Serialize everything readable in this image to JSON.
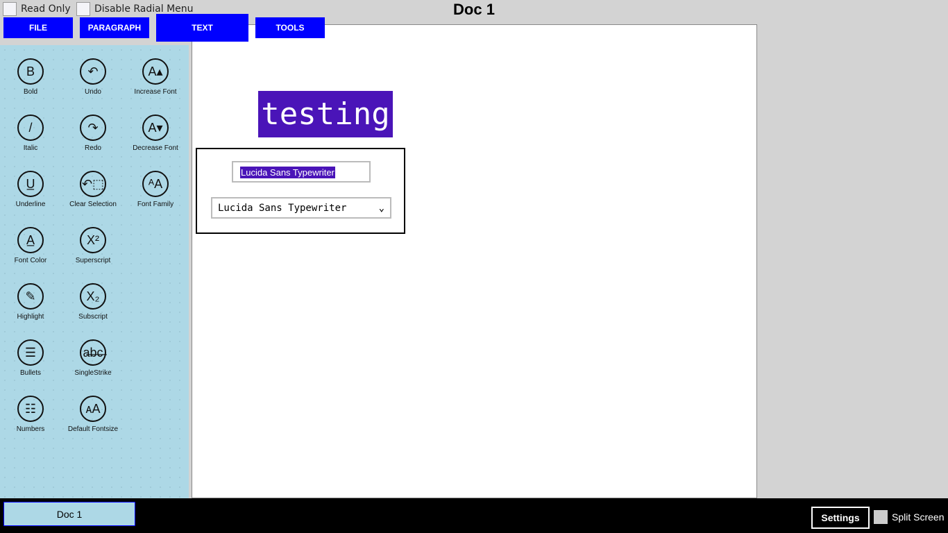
{
  "header": {
    "title": "Doc 1",
    "read_only": "Read Only",
    "disable_radial": "Disable Radial Menu"
  },
  "tabs": [
    {
      "label": "FILE"
    },
    {
      "label": "PARAGRAPH"
    },
    {
      "label": "TEXT",
      "active": true
    },
    {
      "label": "TOOLS"
    }
  ],
  "tools": [
    {
      "label": "Bold",
      "glyph": "B",
      "icon": "bold-icon"
    },
    {
      "label": "Undo",
      "glyph": "↶",
      "icon": "undo-icon"
    },
    {
      "label": "Increase Font",
      "glyph": "A▴",
      "icon": "increase-font-icon"
    },
    {
      "label": "Italic",
      "glyph": "/",
      "icon": "italic-icon"
    },
    {
      "label": "Redo",
      "glyph": "↷",
      "icon": "redo-icon"
    },
    {
      "label": "Decrease Font",
      "glyph": "A▾",
      "icon": "decrease-font-icon"
    },
    {
      "label": "Underline",
      "glyph": "U̲",
      "icon": "underline-icon"
    },
    {
      "label": "Clear Selection",
      "glyph": "↶⬚",
      "icon": "clear-selection-icon"
    },
    {
      "label": "Font Family",
      "glyph": "ᴬA",
      "icon": "font-family-icon"
    },
    {
      "label": "Font Color",
      "glyph": "A̲",
      "icon": "font-color-icon"
    },
    {
      "label": "Superscript",
      "glyph": "X²",
      "icon": "superscript-icon"
    },
    {
      "label": "Highlight",
      "glyph": "✎",
      "icon": "highlight-icon"
    },
    {
      "label": "Subscript",
      "glyph": "X₂",
      "icon": "subscript-icon"
    },
    {
      "label": "Bullets",
      "glyph": "☰",
      "icon": "bullets-icon"
    },
    {
      "label": "SingleStrike",
      "glyph": "a̶b̶c̶",
      "icon": "strikethrough-icon"
    },
    {
      "label": "Numbers",
      "glyph": "☷",
      "icon": "numbers-icon"
    },
    {
      "label": "Default Fontsize",
      "glyph": "ᴀA",
      "icon": "default-fontsize-icon"
    }
  ],
  "document": {
    "text": "testing",
    "font_input": "Lucida Sans Typewriter",
    "font_select": "Lucida Sans Typewriter",
    "highlight_color": "#4a14b8"
  },
  "footer": {
    "doc_tab": "Doc 1",
    "settings": "Settings",
    "split_screen": "Split Screen"
  }
}
